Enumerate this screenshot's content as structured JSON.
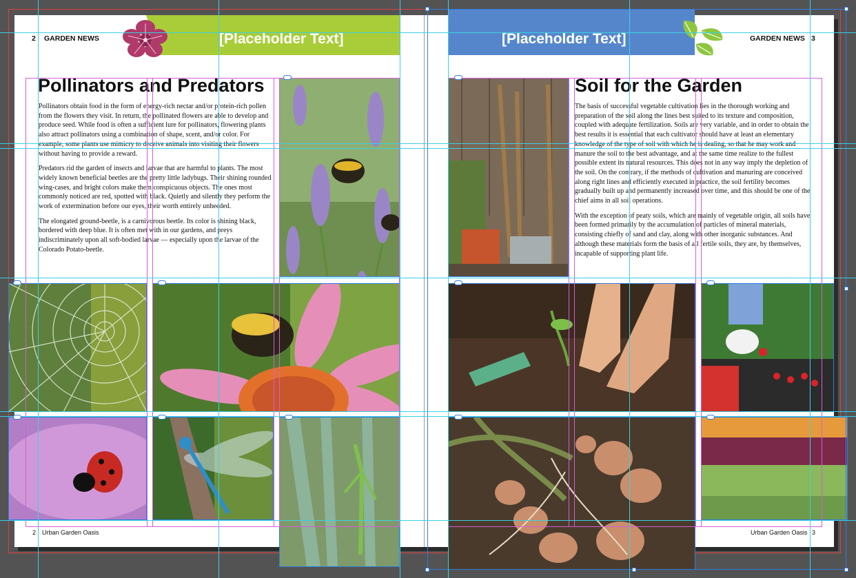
{
  "spread": {
    "left_page": {
      "folio_number": "2",
      "folio_title": "GARDEN NEWS",
      "banner_placeholder": "[Placeholder Text]",
      "headline": "Pollinators and Predators",
      "paragraphs": [
        "Pollinators obtain food in the form of energy-rich nectar and/or protein-rich pollen from the flowers they visit. In return, the pollinated flowers are able to develop and produce seed. While food is often a sufficient lure for pollinators, flowering plants also attract pollinators using a combination of shape, scent, and/or color. For example, some plants use mimicry to deceive animals into visiting their flowers without having to provide a reward.",
        "Predators rid the garden of insects and larvae that are harmful to plants. The most widely known beneficial beetles are the pretty little ladybugs. Their shining rounded wing-cases, and bright colors make them conspicuous objects. The ones most commonly noticed are red, spotted with black. Quietly and silently they perform the work of extermination before our eyes, their worth entirely unheeded.",
        "The elongated ground-beetle, is a carnivorous beetle. Its color is shining black, bordered with deep blue. It is often met with in our gardens, and preys indiscriminately upon all soft-bodied larvae — especially upon the larvae of the Colorado Potato-beetle."
      ],
      "footer_number": "2",
      "footer_text": "Urban Garden Oasis",
      "photos": [
        "bumblebee-on-lavender-photo",
        "spider-web-photo",
        "bee-on-coneflower-photo",
        "ladybug-photo",
        "dragonfly-photo",
        "praying-mantis-photo"
      ]
    },
    "right_page": {
      "folio_number": "3",
      "folio_title": "GARDEN NEWS",
      "banner_placeholder": "[Placeholder Text]",
      "headline": "Soil for the Garden",
      "paragraphs": [
        "The basis of successful vegetable cultivation lies in the thorough working and preparation of the soil along the lines best suited to its texture and composition, coupled with adequate fertilization. Soils are very variable, and in order to obtain the best results it is essential that each cultivator should have at least an elementary knowledge of the type of soil with which he is dealing, so that he may work and manure the soil to the best advantage, and at the same time realize to the fullest possible extent its natural resources. This does not in any way imply the depletion of the soil. On the contrary, if the methods of cultivation and manuring are conceived along right lines and efficiently executed in practice, the soil fertility becomes gradually built up and permanently increased over time, and this should be one of the chief aims in all soil operations.",
        "With the exception of peaty soils, which are mainly of vegetable origin, all soils have been formed primarily by the accumulation of particles of mineral materials, consisting chiefly of sand and clay, along with other inorganic substances. And although these materials form the basis of all fertile soils, they are, by themselves, incapable of supporting plant life."
      ],
      "footer_number": "3",
      "footer_text": "Urban Garden Oasis",
      "photos": [
        "garden-tools-photo",
        "planting-seedling-photo",
        "strawberry-harvest-photo",
        "potato-harvest-photo",
        "lettuce-bed-photo"
      ]
    }
  },
  "colors": {
    "pasteboard": "#535353",
    "green_banner": "#a9cd38",
    "blue_banner": "#5586cc",
    "flower_icon": "#b03a6a",
    "leaf_icon": "#8ec63f",
    "frame_blue": "#2f7de1",
    "guide_cyan": "#3ad0e3",
    "margin_magenta": "#d65cd6",
    "bleed_red": "#e04040"
  },
  "icons": [
    "hibiscus-flower-icon",
    "leaf-sprig-icon",
    "text-thread-link-icon"
  ]
}
